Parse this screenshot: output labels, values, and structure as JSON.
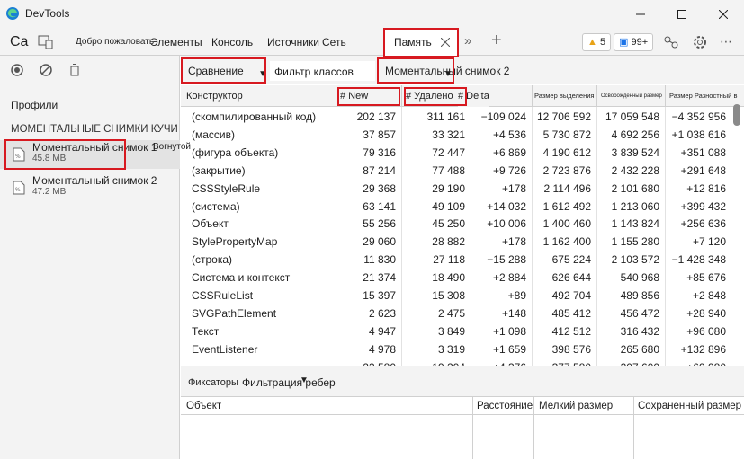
{
  "window": {
    "title": "DevTools"
  },
  "tabs": {
    "welcome": "Добро пожаловать",
    "elements": "Элементы",
    "console": "Консоль",
    "sources": "Источники",
    "network": "Сеть",
    "memory": "Память",
    "ca": "Ca",
    "warnings": "5",
    "messages": "99+"
  },
  "left": {
    "profiles": "Профили",
    "section": "МОМЕНТАЛЬНЫЕ СНИМКИ КУЧИ",
    "snapshots": [
      {
        "name": "Моментальный снимок 1",
        "size": "45.8 MB",
        "collapse": "Вогнутой"
      },
      {
        "name": "Моментальный снимок 2",
        "size": "47.2 MB"
      }
    ]
  },
  "toolbar": {
    "view": "Сравнение",
    "filter_placeholder": "Фильтр классов",
    "base_snapshot": "Моментальный снимок 2"
  },
  "grid": {
    "headers": [
      "Конструктор",
      "# New",
      "# Удалено",
      "# Delta",
      "Размер выделения",
      "Освобожденный размер",
      "Размер Разностный в"
    ],
    "rows": [
      [
        "(скомпилированный код)",
        "202 137",
        "311 161",
        "−109 024",
        "12 706 592",
        "17 059 548",
        "−4 352 956"
      ],
      [
        "(массив)",
        "37 857",
        "33 321",
        "+4 536",
        "5 730 872",
        "4 692 256",
        "+1 038 616"
      ],
      [
        "(фигура объекта)",
        "79 316",
        "72 447",
        "+6 869",
        "4 190 612",
        "3 839 524",
        "+351 088"
      ],
      [
        "(закрытие)",
        "87 214",
        "77 488",
        "+9 726",
        "2 723 876",
        "2 432 228",
        "+291 648"
      ],
      [
        "CSSStyleRule",
        "29 368",
        "29 190",
        "+178",
        "2 114 496",
        "2 101 680",
        "+12 816"
      ],
      [
        "(система)",
        "63 141",
        "49 109",
        "+14 032",
        "1 612 492",
        "1 213 060",
        "+399 432"
      ],
      [
        "Объект",
        "55 256",
        "45 250",
        "+10 006",
        "1 400 460",
        "1 143 824",
        "+256 636"
      ],
      [
        "StylePropertyMap",
        "29 060",
        "28 882",
        "+178",
        "1 162 400",
        "1 155 280",
        "+7 120"
      ],
      [
        "(строка)",
        "11 830",
        "27 118",
        "−15 288",
        "675 224",
        "2 103 572",
        "−1 428 348"
      ],
      [
        "Система и контекст",
        "21 374",
        "18 490",
        "+2 884",
        "626 644",
        "540 968",
        "+85 676"
      ],
      [
        "CSSRuleList",
        "15 397",
        "15 308",
        "+89",
        "492 704",
        "489 856",
        "+2 848"
      ],
      [
        "SVGPathElement",
        "2 623",
        "2 475",
        "+148",
        "485 412",
        "456 472",
        "+28 940"
      ],
      [
        "Текст",
        "4 947",
        "3 849",
        "+1 098",
        "412 512",
        "316 432",
        "+96 080"
      ],
      [
        "EventListener",
        "4 978",
        "3 319",
        "+1 659",
        "398 576",
        "265 680",
        "+132 896"
      ],
      [
        "",
        "23 580",
        "19 204",
        "+4 376",
        "377 580",
        "307 600",
        "+69 980"
      ]
    ]
  },
  "retainers": {
    "title": "Фиксаторы",
    "filter": "Фильтрация ребер",
    "headers": [
      "Объект",
      "Расстояние",
      "Мелкий размер",
      "Сохраненный размер"
    ]
  }
}
